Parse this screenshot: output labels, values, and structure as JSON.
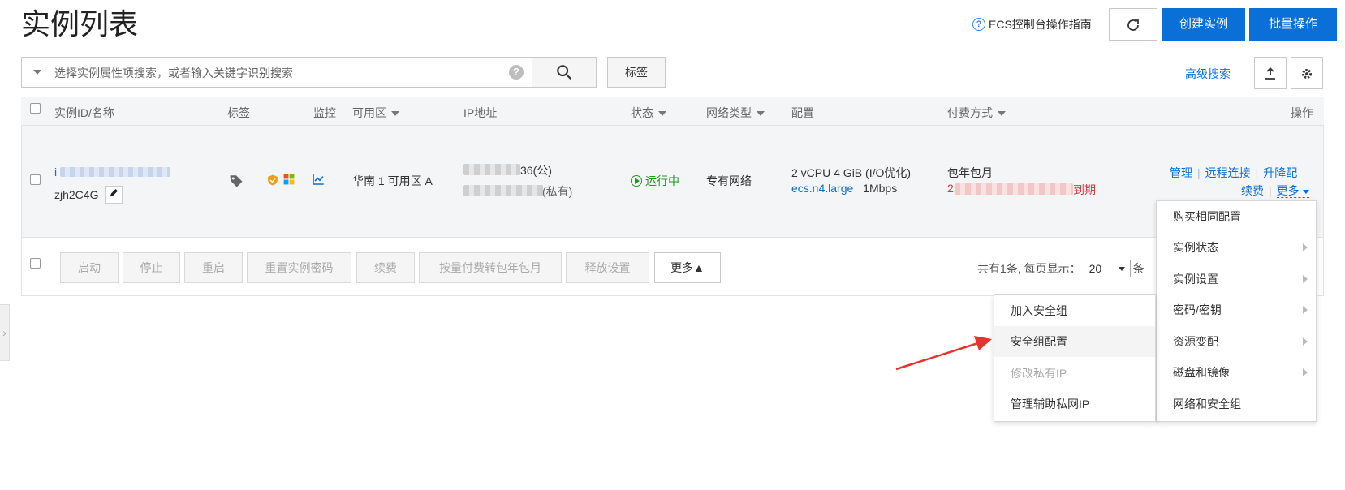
{
  "header": {
    "title": "实例列表",
    "guide_label": "ECS控制台操作指南",
    "create_label": "创建实例",
    "batch_label": "批量操作",
    "refresh_icon": "refresh-icon"
  },
  "search": {
    "placeholder": "选择实例属性项搜索，或者输入关键字识别搜索",
    "tag_label": "标签",
    "advanced_label": "高级搜索",
    "help_glyph": "?"
  },
  "table": {
    "headers": {
      "id_name": "实例ID/名称",
      "tags": "标签",
      "monitor": "监控",
      "zone": "可用区",
      "ip": "IP地址",
      "status": "状态",
      "network": "网络类型",
      "config": "配置",
      "billing": "付费方式",
      "actions": "操作"
    },
    "row": {
      "id_prefix": "i",
      "name": "zjh2C4G",
      "zone": "华南 1 可用区 A",
      "ip_public_suffix": "36(公)",
      "ip_private_suffix": "(私有)",
      "status": "运行中",
      "network": "专有网络",
      "config_line1": "2 vCPU 4 GiB (I/O优化)",
      "instance_type": "ecs.n4.large",
      "bandwidth": "1Mbps",
      "billing_type": "包年包月",
      "expire_prefix": "2",
      "expire_suffix": "到期",
      "actions": {
        "manage": "管理",
        "remote": "远程连接",
        "upgrade": "升降配",
        "renew": "续费",
        "more": "更多"
      }
    }
  },
  "bottom_actions": [
    "启动",
    "停止",
    "重启",
    "重置实例密码",
    "续费",
    "按量付费转包年包月",
    "释放设置",
    "更多▲"
  ],
  "pagination": {
    "total_text": "共有1条, 每页显示：",
    "page_size": "20",
    "unit": "条"
  },
  "more_menu": [
    {
      "label": "购买相同配置",
      "submenu": false
    },
    {
      "label": "实例状态",
      "submenu": true
    },
    {
      "label": "实例设置",
      "submenu": true
    },
    {
      "label": "密码/密钥",
      "submenu": true
    },
    {
      "label": "资源变配",
      "submenu": true
    },
    {
      "label": "磁盘和镜像",
      "submenu": true
    },
    {
      "label": "网络和安全组",
      "submenu": false
    }
  ],
  "network_submenu": [
    {
      "label": "加入安全组",
      "state": "normal"
    },
    {
      "label": "安全组配置",
      "state": "highlighted"
    },
    {
      "label": "修改私有IP",
      "state": "disabled"
    },
    {
      "label": "管理辅助私网IP",
      "state": "normal"
    }
  ],
  "colors": {
    "primary": "#0a6fd6",
    "running": "#1b9d1b",
    "expire": "#d9363e",
    "annotation_arrow": "#e8322d"
  }
}
